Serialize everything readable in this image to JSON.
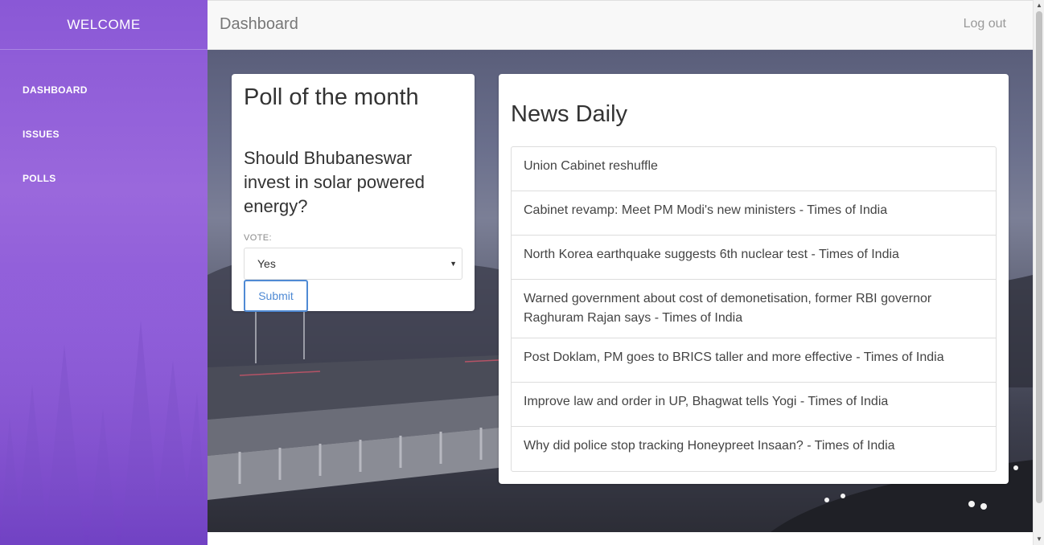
{
  "sidebar": {
    "title": "WELCOME",
    "items": [
      {
        "label": "DASHBOARD"
      },
      {
        "label": "ISSUES"
      },
      {
        "label": "POLLS"
      }
    ],
    "gradient_color": "#8a58d6"
  },
  "topbar": {
    "title": "Dashboard",
    "logout_label": "Log out"
  },
  "poll": {
    "title": "Poll of the month",
    "question": "Should Bhubaneswar invest in solar powered energy?",
    "vote_label": "VOTE:",
    "selected_option": "Yes",
    "submit_label": "Submit",
    "accent_color": "#4f8ad4"
  },
  "news": {
    "title": "News Daily",
    "items": [
      {
        "headline": "Union Cabinet reshuffle"
      },
      {
        "headline": "Cabinet revamp: Meet PM Modi's new ministers - Times of India"
      },
      {
        "headline": "North Korea earthquake suggests 6th nuclear test - Times of India"
      },
      {
        "headline": "Warned government about cost of demonetisation, former RBI governor Raghuram Rajan says - Times of India"
      },
      {
        "headline": "Post Doklam, PM goes to BRICS taller and more effective - Times of India"
      },
      {
        "headline": "Improve law and order in UP, Bhagwat tells Yogi - Times of India"
      },
      {
        "headline": "Why did police stop tracking Honeypreet Insaan? - Times of India"
      }
    ]
  }
}
